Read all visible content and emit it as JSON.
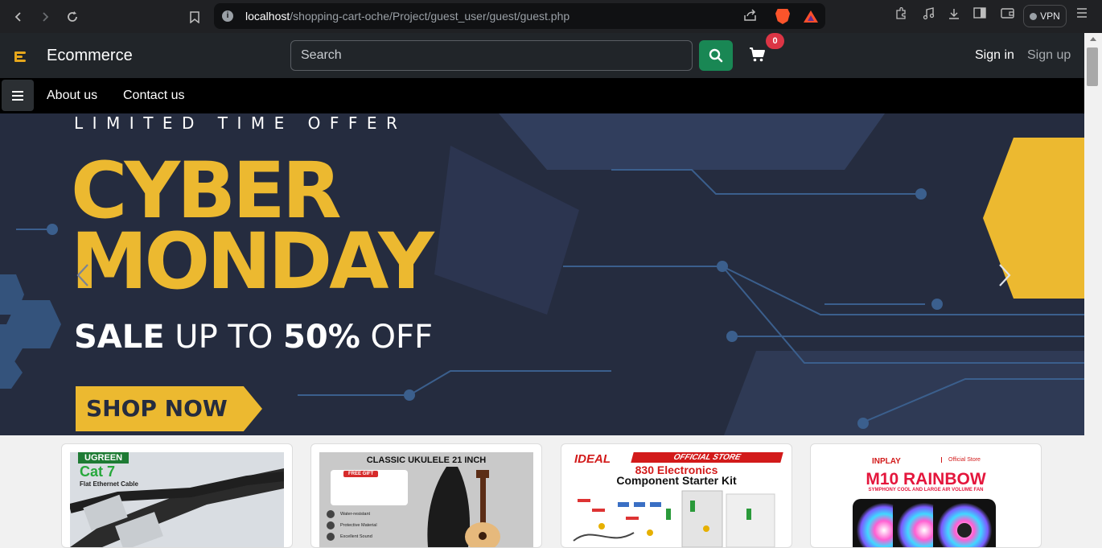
{
  "browser": {
    "url_host": "localhost",
    "url_path": "/shopping-cart-oche/Project/guest_user/guest/guest.php",
    "vpn_label": "VPN",
    "icons": [
      "back-icon",
      "forward-icon",
      "reload-icon",
      "bookmark-icon",
      "site-info-icon",
      "share-icon",
      "brave-shields-icon",
      "brave-rewards-icon",
      "extensions-icon",
      "media-icon",
      "download-icon",
      "sidebar-icon",
      "wallet-icon",
      "menu-icon"
    ]
  },
  "navbar": {
    "brand": "Ecommerce",
    "search_placeholder": "Search",
    "cart_count": "0",
    "signin": "Sign in",
    "signup": "Sign up"
  },
  "subnav": {
    "links": [
      "About us",
      "Contact us"
    ]
  },
  "hero": {
    "kicker": "LIMITED TIME OFFER",
    "title_line1": "CYBER",
    "title_line2": "MONDAY",
    "sale_prefix": "SALE",
    "sale_mid": "UP TO",
    "sale_pct": "50%",
    "sale_suffix": "OFF",
    "cta": "SHOP NOW"
  },
  "products": [
    {
      "brand": "UGREEN",
      "title": "Cat 7",
      "subtitle": "Flat Ethernet Cable"
    },
    {
      "title": "CLASSIC UKULELE 21 INCH",
      "badge": "FREE GIFT",
      "features": [
        "Water-resistant",
        "Protective Material",
        "Excellent Sound"
      ]
    },
    {
      "store": "IDEAL",
      "store_tag": "OFFICIAL STORE",
      "title_line1": "830 Electronics",
      "title_line2": "Component Starter Kit"
    },
    {
      "brand": "INPLAY",
      "store": "Official Store",
      "title": "M10 RAINBOW",
      "subtitle": "SYMPHONY COOL AND LARGE AIR VOLUME FAN"
    }
  ],
  "colors": {
    "navbar": "#212529",
    "search_button": "#198754",
    "badge": "#dc3545",
    "hero_bg": "#252c3f",
    "hero_accent": "#ecb930"
  }
}
